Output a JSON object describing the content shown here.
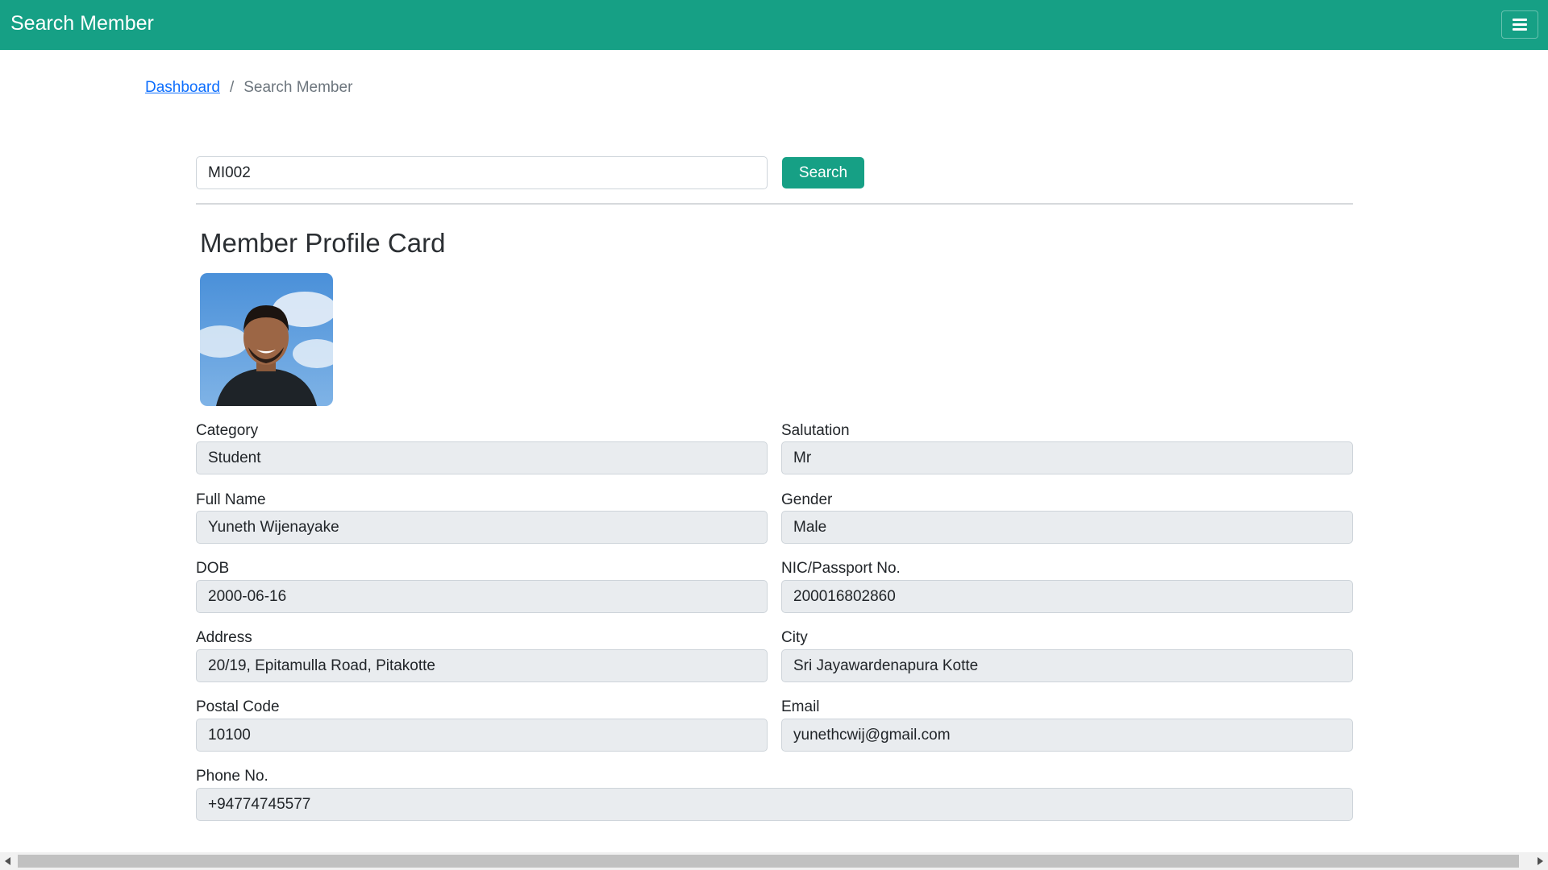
{
  "header": {
    "title": "Search Member",
    "menu_icon": "hamburger-menu-icon",
    "color": "#16a085"
  },
  "breadcrumb": {
    "home": "Dashboard",
    "separator": "/",
    "current": "Search Member"
  },
  "search": {
    "value": "MI002",
    "button_label": "Search"
  },
  "card": {
    "title": "Member Profile Card",
    "photo_icon": "member-photo"
  },
  "fields": {
    "category": {
      "label": "Category",
      "value": "Student"
    },
    "salutation": {
      "label": "Salutation",
      "value": "Mr"
    },
    "full_name": {
      "label": "Full Name",
      "value": "Yuneth Wijenayake"
    },
    "gender": {
      "label": "Gender",
      "value": "Male"
    },
    "dob": {
      "label": "DOB",
      "value": "2000-06-16"
    },
    "nic": {
      "label": "NIC/Passport No.",
      "value": "200016802860"
    },
    "address": {
      "label": "Address",
      "value": "20/19, Epitamulla Road, Pitakotte"
    },
    "city": {
      "label": "City",
      "value": "Sri Jayawardenapura Kotte"
    },
    "postal_code": {
      "label": "Postal Code",
      "value": "10100"
    },
    "email": {
      "label": "Email",
      "value": "yunethcwij@gmail.com"
    },
    "phone": {
      "label": "Phone No.",
      "value": "+94774745577"
    }
  },
  "colors": {
    "accent": "#16a085",
    "link": "#0d6efd",
    "readonly_field": "#e9ecef"
  }
}
